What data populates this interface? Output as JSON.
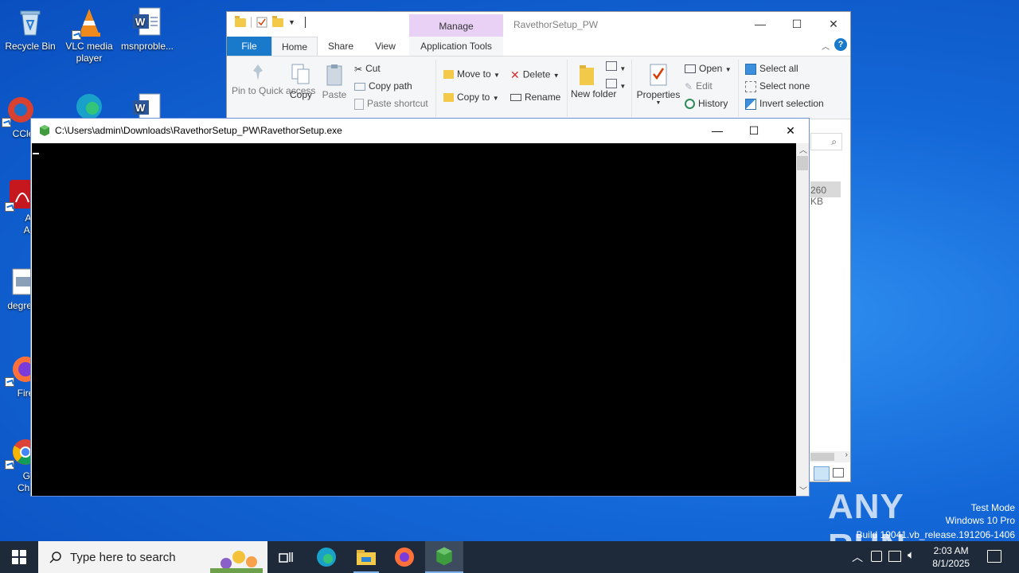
{
  "desktop": {
    "icons": [
      {
        "label": "Recycle Bin"
      },
      {
        "label": "VLC media player"
      },
      {
        "label": "msnproble..."
      },
      {
        "label": "CCle"
      },
      {
        "label": "Ado Acro"
      },
      {
        "label": "degree"
      },
      {
        "label": "Fire"
      },
      {
        "label": "Goo Chrom"
      }
    ]
  },
  "explorer": {
    "title": "RavethorSetup_PW",
    "manage_tab": "Manage",
    "tabs": [
      "File",
      "Home",
      "Share",
      "View",
      "Application Tools"
    ],
    "ribbon": {
      "pin": "Pin to Quick access",
      "copy": "Copy",
      "paste": "Paste",
      "cut": "Cut",
      "copy_path": "Copy path",
      "paste_shortcut": "Paste shortcut",
      "move_to": "Move to",
      "copy_to": "Copy to",
      "delete": "Delete",
      "rename": "Rename",
      "new_folder": "New folder",
      "properties": "Properties",
      "open": "Open",
      "edit": "Edit",
      "history": "History",
      "select_all": "Select all",
      "select_none": "Select none",
      "invert_selection": "Invert selection"
    },
    "file_size": "260 KB"
  },
  "console": {
    "title": "C:\\Users\\admin\\Downloads\\RavethorSetup_PW\\RavethorSetup.exe"
  },
  "taskbar": {
    "search_placeholder": "Type here to search",
    "time": "2:03 AM",
    "date": "8/1/2025"
  },
  "watermark": {
    "brand": "ANY RUN",
    "line1": "Test Mode",
    "line2": "Windows 10 Pro",
    "line3": "Build 19041.vb_release.191206-1406"
  }
}
